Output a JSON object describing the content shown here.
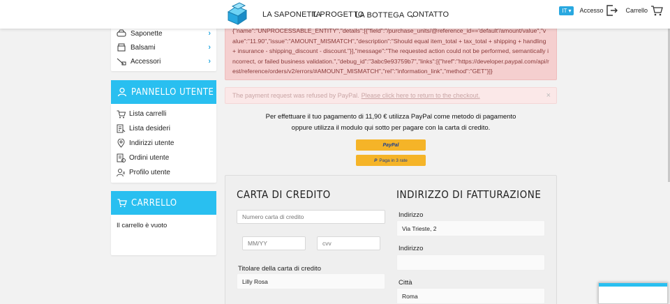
{
  "nav": {
    "items": [
      "LA SAPONETTA",
      "IL PROGETTO",
      "LA BOTTEGA",
      "CONTATTO"
    ],
    "lang": "IT",
    "login_label": "Accesso",
    "cart_label": "Carrello"
  },
  "categories": [
    {
      "label": "Saponette"
    },
    {
      "label": "Balsami"
    },
    {
      "label": "Accessori"
    }
  ],
  "user_panel": {
    "title": "PANNELLO UTENTE",
    "items": [
      "Lista carrelli",
      "Lista desideri",
      "Indirizzi utente",
      "Ordini utente",
      "Profilo utente"
    ]
  },
  "cart_panel": {
    "title": "CARRELLO",
    "empty_text": "Il carrello è vuoto"
  },
  "error_alert": {
    "text": "{\"name\":\"UNPROCESSABLE_ENTITY\",\"details\":[{\"field\":\"/purchase_units/@reference_id=='default'/amount/value\",\"value\":\"11.90\",\"issue\":\"AMOUNT_MISMATCH\",\"description\":\"Should equal item_total + tax_total + shipping + handling + insurance - shipping_discount - discount.\"}],\"message\":\"The requested action could not be performed, semantically incorrect, or failed business validation.\",\"debug_id\":\"3abc9e93759b7\",\"links\":[{\"href\":\"https://developer.paypal.com/api/rest/reference/orders/v2/errors/#AMOUNT_MISMATCH\",\"rel\":\"information_link\",\"method\":\"GET\"}]}"
  },
  "warning_alert": {
    "text": "The payment request was refused by PayPal.",
    "link": "Please click here to return to the checkout.",
    "close": "×"
  },
  "payment": {
    "line1": "Per effettuare il tuo pagamento di 11,90 € utilizza PayPal come metodo di pagamento",
    "line2": "oppure utilizza il modulo qui sotto per pagare con la carta di credito.",
    "paypal_label": "PayPal",
    "paylater_label": "Paga in 3 rate"
  },
  "card_form": {
    "title": "CARTA DI CREDITO",
    "number_placeholder": "Numero carta di credito",
    "expiry_placeholder": "MM/YY",
    "cvv_placeholder": "cvv",
    "holder_label": "Titolare della carta di credito",
    "holder_value": "Lilly Rosa"
  },
  "billing_form": {
    "title": "INDIRIZZO DI FATTURAZIONE",
    "address_label": "Indirizzo",
    "address_value": "Via Trieste, 2",
    "address2_label": "Indirizzo",
    "address2_value": "",
    "city_label": "Città",
    "city_value": "Roma"
  },
  "colors": {
    "accent": "#29bff0",
    "paypal_button": "#f5b428",
    "error_bg": "#f5cfcf"
  }
}
